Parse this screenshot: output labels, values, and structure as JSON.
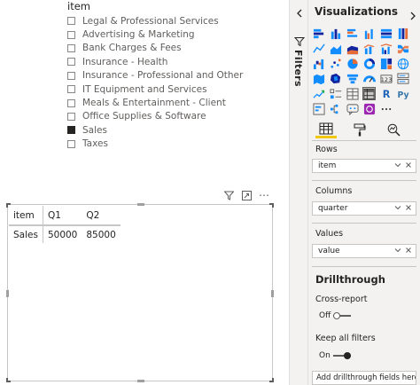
{
  "slicer": {
    "title": "item",
    "items": [
      {
        "label": "Legal & Professional Services",
        "checked": false
      },
      {
        "label": "Advertising & Marketing",
        "checked": false
      },
      {
        "label": "Bank Charges & Fees",
        "checked": false
      },
      {
        "label": "Insurance - Health",
        "checked": false
      },
      {
        "label": "Insurance - Professional and Other",
        "checked": false
      },
      {
        "label": "IT Equipment and Services",
        "checked": false
      },
      {
        "label": "Meals & Entertainment - Client",
        "checked": false
      },
      {
        "label": "Office Supplies & Software",
        "checked": false
      },
      {
        "label": "Sales",
        "checked": true
      },
      {
        "label": "Taxes",
        "checked": false
      }
    ]
  },
  "visual_header": {
    "icons": [
      "filter-icon",
      "focus-mode-icon",
      "more-options-icon"
    ],
    "more_label": "⋯"
  },
  "matrix": {
    "headers": [
      "item",
      "Q1",
      "Q2"
    ],
    "rows": [
      {
        "label": "Sales",
        "values": [
          "50000",
          "85000"
        ]
      }
    ]
  },
  "filters_pane": {
    "label": "Filters",
    "collapsed": true
  },
  "visualizations": {
    "title": "Visualizations",
    "gallery": [
      "stacked-bar-chart-icon",
      "stacked-column-chart-icon",
      "clustered-bar-chart-icon",
      "clustered-column-chart-icon",
      "100-bar-chart-icon",
      "100-column-chart-icon",
      "line-chart-icon",
      "area-chart-icon",
      "stacked-area-chart-icon",
      "line-column-chart-icon",
      "line-clustered-column-icon",
      "ribbon-chart-icon",
      "waterfall-chart-icon",
      "scatter-chart-icon",
      "pie-chart-icon",
      "donut-chart-icon",
      "treemap-icon",
      "map-icon",
      "filled-map-icon",
      "shape-map-icon",
      "funnel-icon",
      "gauge-icon",
      "card-icon",
      "multi-row-card-icon",
      "kpi-icon",
      "slicer-icon",
      "table-icon",
      "matrix-icon",
      "r-script-icon",
      "python-visual-icon",
      "key-influencers-icon",
      "decomposition-tree-icon",
      "qa-icon",
      "arcgis-icon",
      "more-visuals-icon"
    ],
    "selected_visual": "matrix-icon",
    "tabs": [
      "fields-tab-icon",
      "format-paint-roller-icon",
      "analytics-magnifier-icon"
    ],
    "active_tab": "fields-tab-icon",
    "rows_label": "Rows",
    "rows_field": "item",
    "columns_label": "Columns",
    "columns_field": "quarter",
    "values_label": "Values",
    "values_field": "value",
    "drillthrough": {
      "title": "Drillthrough",
      "cross_report_label": "Cross-report",
      "cross_report_state": "Off",
      "keep_filters_label": "Keep all filters",
      "keep_filters_state": "On",
      "placeholder": "Add drillthrough fields here"
    }
  },
  "colors": {
    "pane_bg": "#f3f2f1",
    "accent_yellow": "#f2c80f",
    "text_primary": "#252423",
    "border": "#c8c6c4"
  }
}
